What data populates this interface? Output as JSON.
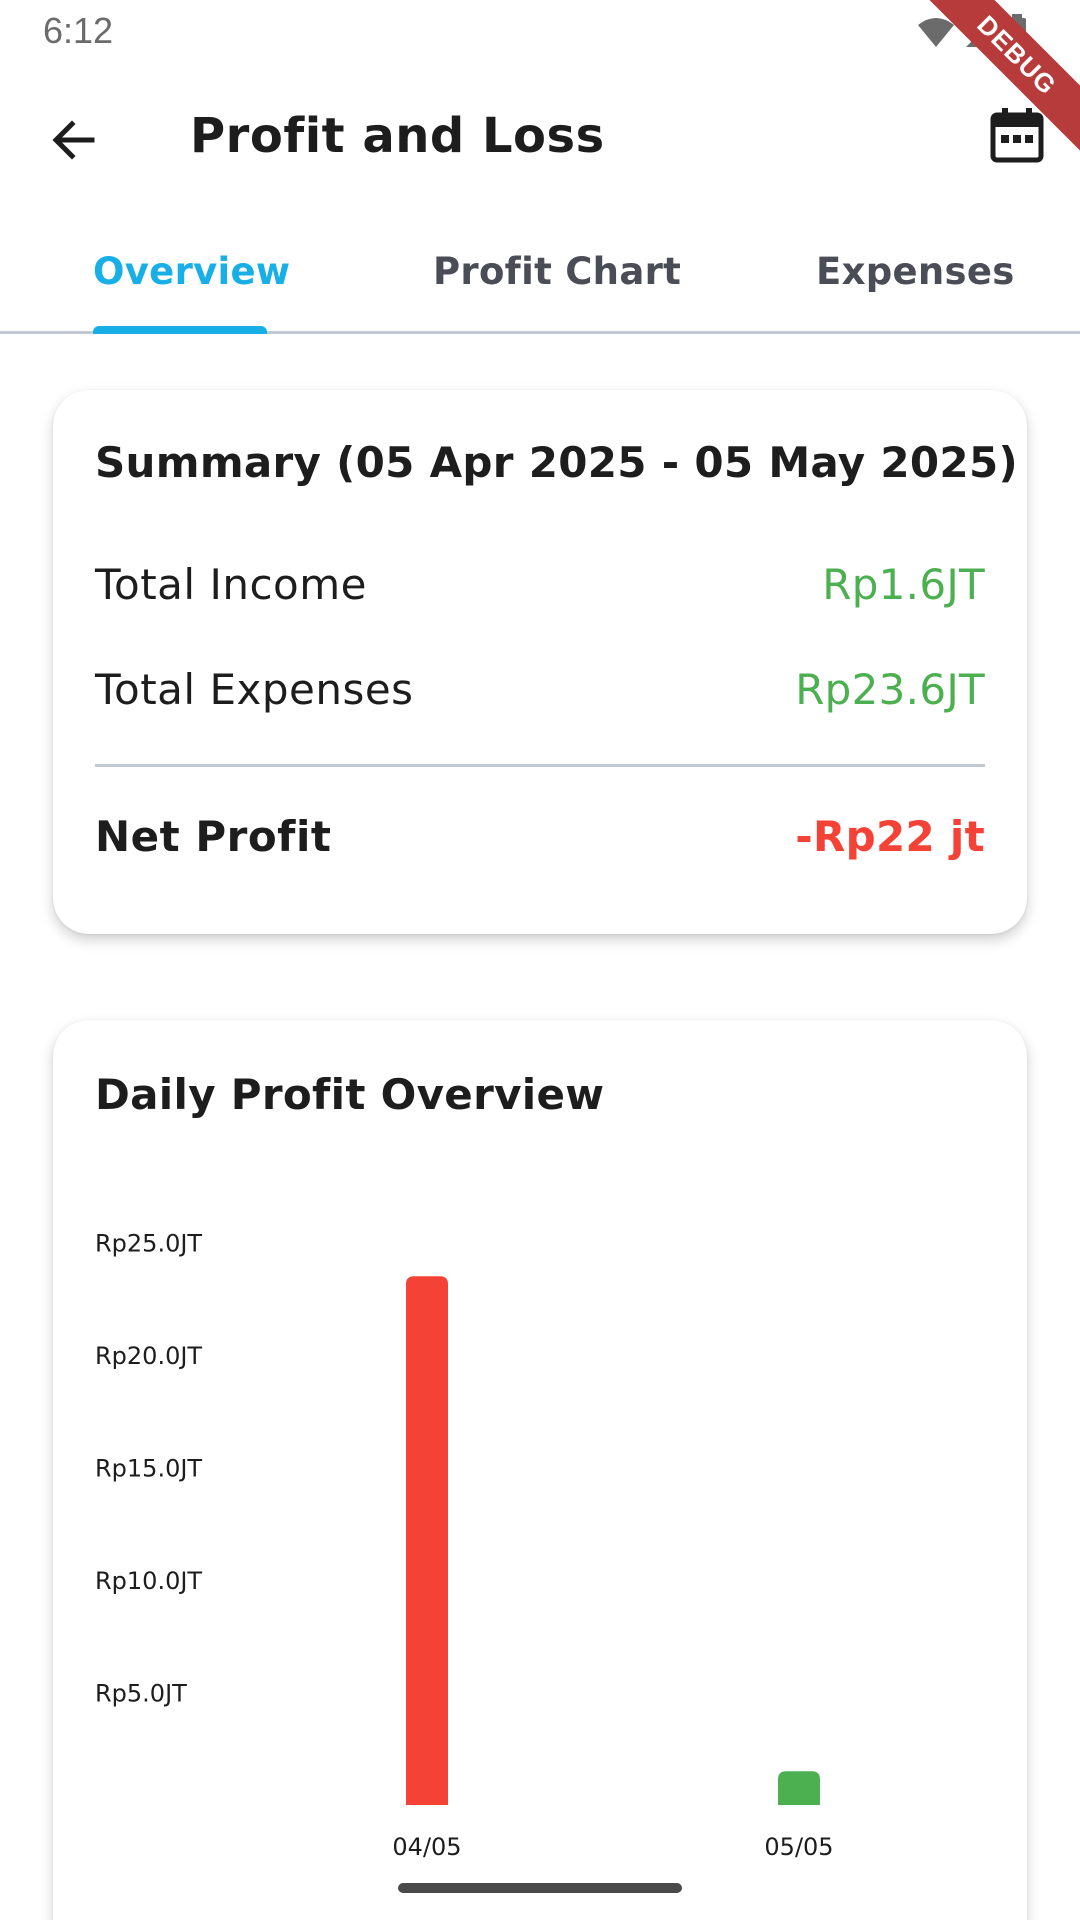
{
  "status_bar": {
    "time": "6:12"
  },
  "debug_banner": {
    "label": "DEBUG"
  },
  "app_bar": {
    "title": "Profit and Loss",
    "back_icon": "arrow-back-icon",
    "calendar_icon": "calendar-icon"
  },
  "tabs": [
    {
      "label": "Overview",
      "active": true
    },
    {
      "label": "Profit Chart",
      "active": false
    },
    {
      "label": "Expenses",
      "active": false
    }
  ],
  "summary": {
    "title": "Summary (05 Apr 2025 - 05 May 2025)",
    "total_income_label": "Total Income",
    "total_income_value": "Rp1.6JT",
    "total_expenses_label": "Total Expenses",
    "total_expenses_value": "Rp23.6JT",
    "net_profit_label": "Net Profit",
    "net_profit_value": "-Rp22 jt"
  },
  "colors": {
    "accent": "#18aee6",
    "positive": "#4caf50",
    "negative": "#f44336"
  },
  "chart_data": {
    "type": "bar",
    "title": "Daily Profit Overview",
    "categories": [
      "04/05",
      "05/05"
    ],
    "values": [
      23.5,
      1.5
    ],
    "bar_colors": [
      "#f44336",
      "#4caf50"
    ],
    "ylim": [
      0,
      25
    ],
    "y_ticks": [
      {
        "value": 25,
        "label": "Rp25.0JT"
      },
      {
        "value": 20,
        "label": "Rp20.0JT"
      },
      {
        "value": 15,
        "label": "Rp15.0JT"
      },
      {
        "value": 10,
        "label": "Rp10.0JT"
      },
      {
        "value": 5,
        "label": "Rp5.0JT"
      }
    ],
    "grid": false,
    "legend": "none"
  }
}
